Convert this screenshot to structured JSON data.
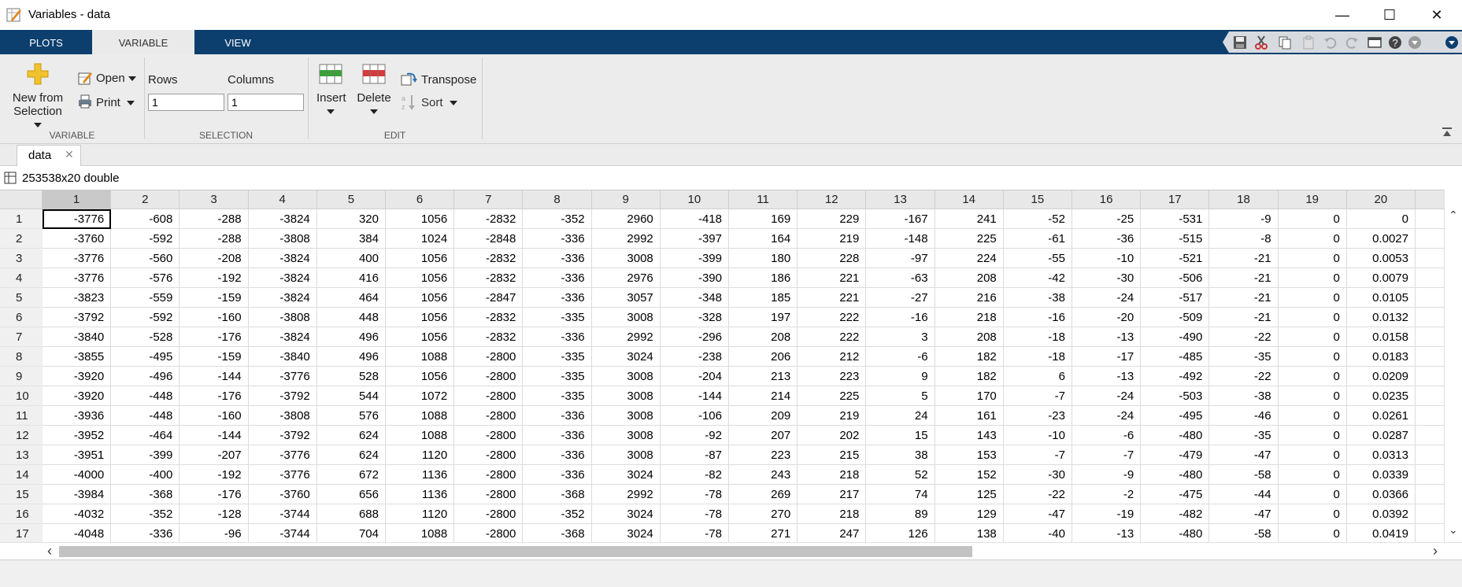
{
  "window": {
    "title": "Variables - data",
    "minimize": "—",
    "maximize": "☐",
    "close": "✕"
  },
  "tabs": [
    {
      "label": "PLOTS",
      "active": false
    },
    {
      "label": "VARIABLE",
      "active": true
    },
    {
      "label": "VIEW",
      "active": false
    }
  ],
  "quick_access": [
    "save-icon",
    "cut-icon",
    "copy-icon",
    "paste-icon",
    "undo-icon",
    "redo-icon",
    "switch-windows-icon",
    "help-icon",
    "search-docs-icon",
    "expand-icon"
  ],
  "ribbon": {
    "variable": {
      "group_label": "VARIABLE",
      "new_from_selection": [
        "New from",
        "Selection"
      ],
      "open": "Open",
      "print": "Print"
    },
    "selection": {
      "group_label": "SELECTION",
      "rows_label": "Rows",
      "columns_label": "Columns",
      "rows_value": "1",
      "columns_value": "1"
    },
    "edit": {
      "group_label": "EDIT",
      "insert": "Insert",
      "delete": "Delete",
      "transpose": "Transpose",
      "sort": "Sort"
    }
  },
  "doc_tab": {
    "label": "data",
    "close": "✕"
  },
  "info": {
    "text": "253538x20 double"
  },
  "table": {
    "columns": [
      "1",
      "2",
      "3",
      "4",
      "5",
      "6",
      "7",
      "8",
      "9",
      "10",
      "11",
      "12",
      "13",
      "14",
      "15",
      "16",
      "17",
      "18",
      "19",
      "20",
      "2"
    ],
    "rows": [
      [
        "1",
        [
          "-3776",
          "-608",
          "-288",
          "-3824",
          "320",
          "1056",
          "-2832",
          "-352",
          "2960",
          "-418",
          "169",
          "229",
          "-167",
          "241",
          "-52",
          "-25",
          "-531",
          "-9",
          "0",
          "0"
        ]
      ],
      [
        "2",
        [
          "-3760",
          "-592",
          "-288",
          "-3808",
          "384",
          "1024",
          "-2848",
          "-336",
          "2992",
          "-397",
          "164",
          "219",
          "-148",
          "225",
          "-61",
          "-36",
          "-515",
          "-8",
          "0",
          "0.0027"
        ]
      ],
      [
        "3",
        [
          "-3776",
          "-560",
          "-208",
          "-3824",
          "400",
          "1056",
          "-2832",
          "-336",
          "3008",
          "-399",
          "180",
          "228",
          "-97",
          "224",
          "-55",
          "-10",
          "-521",
          "-21",
          "0",
          "0.0053"
        ]
      ],
      [
        "4",
        [
          "-3776",
          "-576",
          "-192",
          "-3824",
          "416",
          "1056",
          "-2832",
          "-336",
          "2976",
          "-390",
          "186",
          "221",
          "-63",
          "208",
          "-42",
          "-30",
          "-506",
          "-21",
          "0",
          "0.0079"
        ]
      ],
      [
        "5",
        [
          "-3823",
          "-559",
          "-159",
          "-3824",
          "464",
          "1056",
          "-2847",
          "-336",
          "3057",
          "-348",
          "185",
          "221",
          "-27",
          "216",
          "-38",
          "-24",
          "-517",
          "-21",
          "0",
          "0.0105"
        ]
      ],
      [
        "6",
        [
          "-3792",
          "-592",
          "-160",
          "-3808",
          "448",
          "1056",
          "-2832",
          "-335",
          "3008",
          "-328",
          "197",
          "222",
          "-16",
          "218",
          "-16",
          "-20",
          "-509",
          "-21",
          "0",
          "0.0132"
        ]
      ],
      [
        "7",
        [
          "-3840",
          "-528",
          "-176",
          "-3824",
          "496",
          "1056",
          "-2832",
          "-336",
          "2992",
          "-296",
          "208",
          "222",
          "3",
          "208",
          "-18",
          "-13",
          "-490",
          "-22",
          "0",
          "0.0158"
        ]
      ],
      [
        "8",
        [
          "-3855",
          "-495",
          "-159",
          "-3840",
          "496",
          "1088",
          "-2800",
          "-335",
          "3024",
          "-238",
          "206",
          "212",
          "-6",
          "182",
          "-18",
          "-17",
          "-485",
          "-35",
          "0",
          "0.0183"
        ]
      ],
      [
        "9",
        [
          "-3920",
          "-496",
          "-144",
          "-3776",
          "528",
          "1056",
          "-2800",
          "-335",
          "3008",
          "-204",
          "213",
          "223",
          "9",
          "182",
          "6",
          "-13",
          "-492",
          "-22",
          "0",
          "0.0209"
        ]
      ],
      [
        "10",
        [
          "-3920",
          "-448",
          "-176",
          "-3792",
          "544",
          "1072",
          "-2800",
          "-335",
          "3008",
          "-144",
          "214",
          "225",
          "5",
          "170",
          "-7",
          "-24",
          "-503",
          "-38",
          "0",
          "0.0235"
        ]
      ],
      [
        "11",
        [
          "-3936",
          "-448",
          "-160",
          "-3808",
          "576",
          "1088",
          "-2800",
          "-336",
          "3008",
          "-106",
          "209",
          "219",
          "24",
          "161",
          "-23",
          "-24",
          "-495",
          "-46",
          "0",
          "0.0261"
        ]
      ],
      [
        "12",
        [
          "-3952",
          "-464",
          "-144",
          "-3792",
          "624",
          "1088",
          "-2800",
          "-336",
          "3008",
          "-92",
          "207",
          "202",
          "15",
          "143",
          "-10",
          "-6",
          "-480",
          "-35",
          "0",
          "0.0287"
        ]
      ],
      [
        "13",
        [
          "-3951",
          "-399",
          "-207",
          "-3776",
          "624",
          "1120",
          "-2800",
          "-336",
          "3008",
          "-87",
          "223",
          "215",
          "38",
          "153",
          "-7",
          "-7",
          "-479",
          "-47",
          "0",
          "0.0313"
        ]
      ],
      [
        "14",
        [
          "-4000",
          "-400",
          "-192",
          "-3776",
          "672",
          "1136",
          "-2800",
          "-336",
          "3024",
          "-82",
          "243",
          "218",
          "52",
          "152",
          "-30",
          "-9",
          "-480",
          "-58",
          "0",
          "0.0339"
        ]
      ],
      [
        "15",
        [
          "-3984",
          "-368",
          "-176",
          "-3760",
          "656",
          "1136",
          "-2800",
          "-368",
          "2992",
          "-78",
          "269",
          "217",
          "74",
          "125",
          "-22",
          "-2",
          "-475",
          "-44",
          "0",
          "0.0366"
        ]
      ],
      [
        "16",
        [
          "-4032",
          "-352",
          "-128",
          "-3744",
          "688",
          "1120",
          "-2800",
          "-352",
          "3024",
          "-78",
          "270",
          "218",
          "89",
          "129",
          "-47",
          "-19",
          "-482",
          "-47",
          "0",
          "0.0392"
        ]
      ],
      [
        "17",
        [
          "-4048",
          "-336",
          "-96",
          "-3744",
          "704",
          "1088",
          "-2800",
          "-368",
          "3024",
          "-78",
          "271",
          "247",
          "126",
          "138",
          "-40",
          "-13",
          "-480",
          "-58",
          "0",
          "0.0419"
        ]
      ]
    ]
  },
  "scroll": {
    "up": "⌃",
    "down": "⌄",
    "left": "‹",
    "right": "›"
  }
}
